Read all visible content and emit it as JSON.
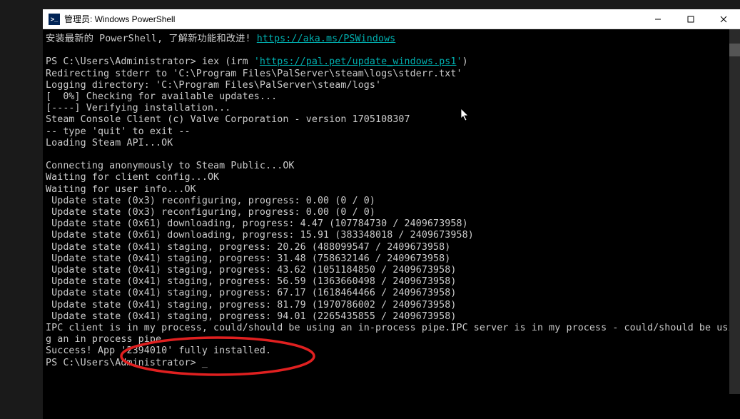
{
  "window": {
    "title": "管理员: Windows PowerShell",
    "icon_label": ">_"
  },
  "terminal": {
    "intro": "安装最新的 PowerShell, 了解新功能和改进! ",
    "intro_url": "https://aka.ms/PSWindows",
    "prompt1": "PS C:\\Users\\Administrator> ",
    "cmd_prefix": "iex (irm ",
    "cmd_q1": "'",
    "cmd_url": "https://pal.pet/update_windows.ps1",
    "cmd_q2": "'",
    "cmd_suffix": ")",
    "lines": [
      "Redirecting stderr to 'C:\\Program Files\\PalServer\\steam\\logs\\stderr.txt'",
      "Logging directory: 'C:\\Program Files\\PalServer\\steam/logs'",
      "[  0%] Checking for available updates...",
      "[----] Verifying installation...",
      "Steam Console Client (c) Valve Corporation - version 1705108307",
      "-- type 'quit' to exit --",
      "Loading Steam API...OK",
      "",
      "Connecting anonymously to Steam Public...OK",
      "Waiting for client config...OK",
      "Waiting for user info...OK",
      " Update state (0x3) reconfiguring, progress: 0.00 (0 / 0)",
      " Update state (0x3) reconfiguring, progress: 0.00 (0 / 0)",
      " Update state (0x61) downloading, progress: 4.47 (107784730 / 2409673958)",
      " Update state (0x61) downloading, progress: 15.91 (383348018 / 2409673958)",
      " Update state (0x41) staging, progress: 20.26 (488099547 / 2409673958)",
      " Update state (0x41) staging, progress: 31.48 (758632146 / 2409673958)",
      " Update state (0x41) staging, progress: 43.62 (1051184850 / 2409673958)",
      " Update state (0x41) staging, progress: 56.59 (1363660498 / 2409673958)",
      " Update state (0x41) staging, progress: 67.17 (1618464466 / 2409673958)",
      " Update state (0x41) staging, progress: 81.79 (1970786002 / 2409673958)",
      " Update state (0x41) staging, progress: 94.01 (2265435855 / 2409673958)",
      "IPC client is in my process, could/should be using an in-process pipe.IPC server is in my process - could/should be usin",
      "g an in process pipe",
      "Success! App '2394010' fully installed."
    ],
    "prompt2": "PS C:\\Users\\Administrator> _"
  }
}
